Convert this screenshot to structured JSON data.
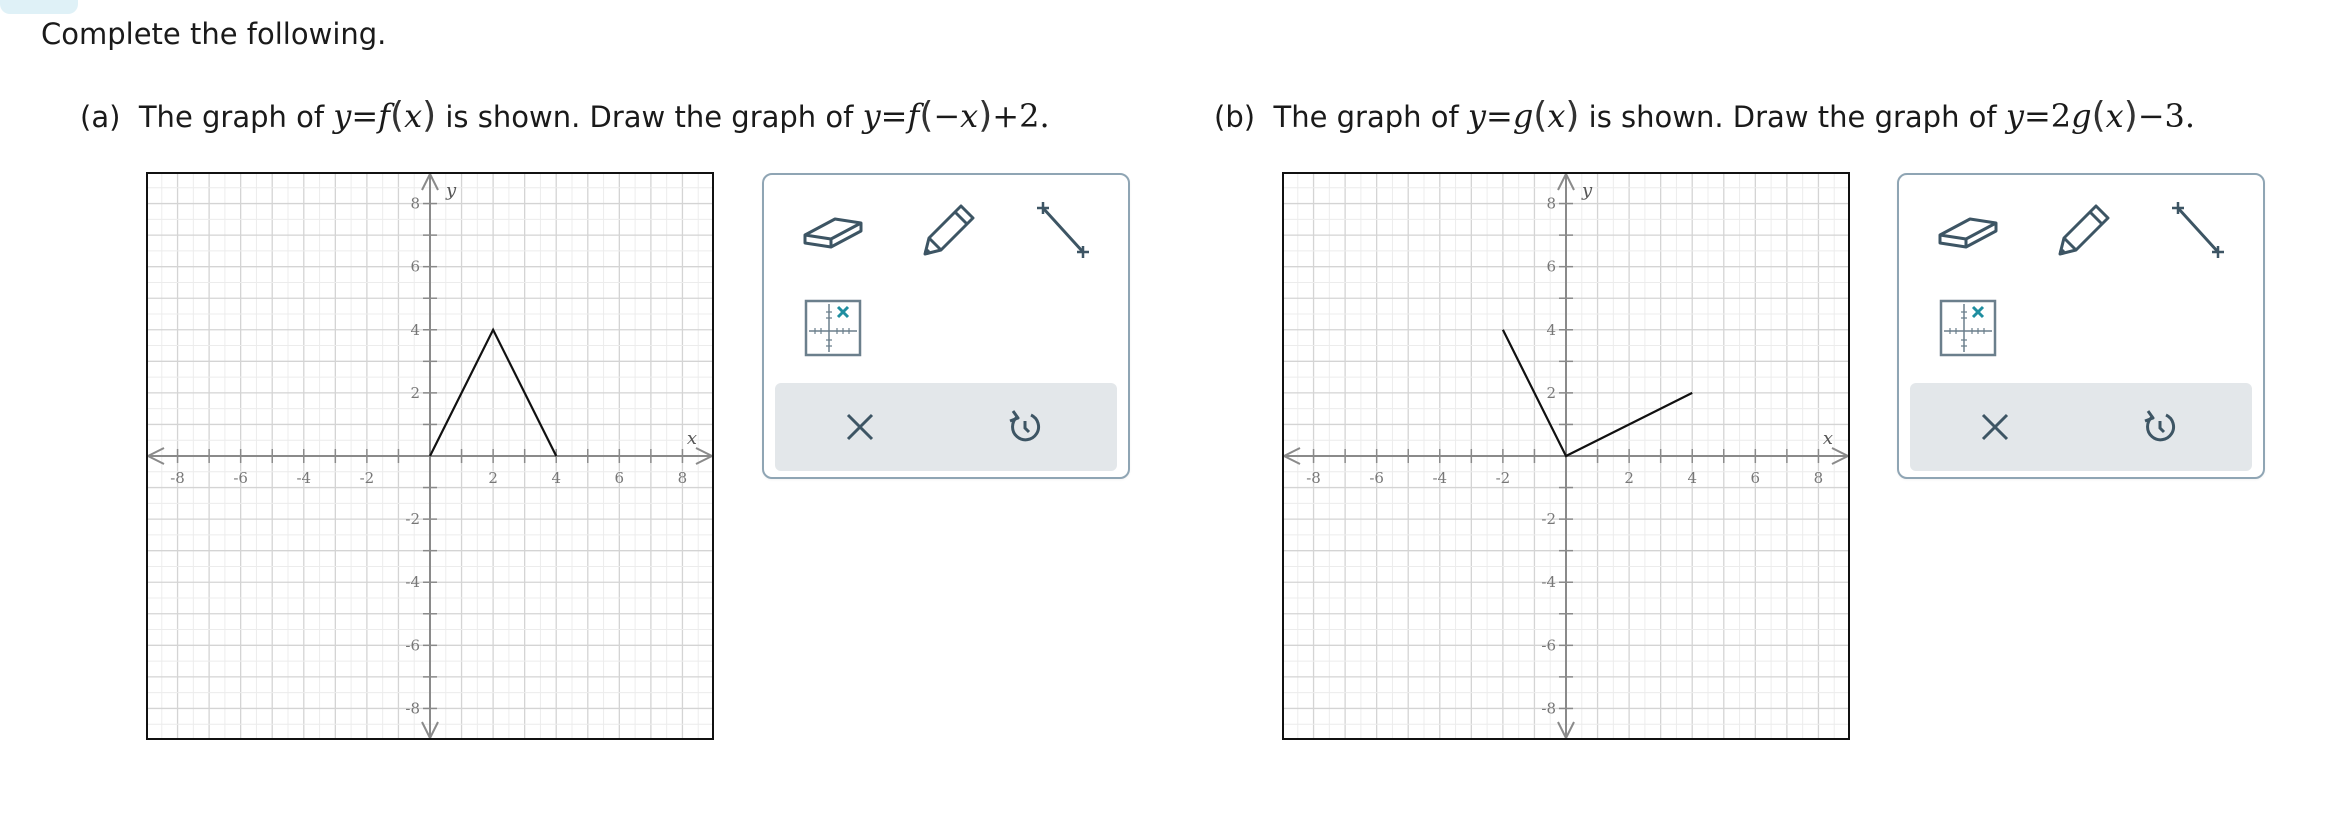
{
  "instruction": "Complete the following.",
  "parts": [
    {
      "label": "(a)",
      "text_before": "The graph of",
      "given": "y=f(x)",
      "text_middle": "is shown. Draw the graph of",
      "target": "y=f(−x)+2."
    },
    {
      "label": "(b)",
      "text_before": "The graph of",
      "given": "y=g(x)",
      "text_middle": "is shown. Draw the graph of",
      "target": "y=2g(x)−3."
    }
  ],
  "graph": {
    "x_label": "x",
    "y_label": "y",
    "x_range": [
      -9,
      9
    ],
    "y_range": [
      -9,
      9
    ],
    "x_ticks": [
      "-8",
      "-6",
      "-4",
      "-2",
      "2",
      "4",
      "6",
      "8"
    ],
    "y_ticks": [
      "8",
      "6",
      "4",
      "2",
      "-2",
      "-4",
      "-6",
      "-8"
    ]
  },
  "graph_a_polyline": [
    [
      0,
      0
    ],
    [
      2,
      4
    ],
    [
      4,
      0
    ]
  ],
  "graph_b_polyline": [
    [
      -2,
      4
    ],
    [
      0,
      0
    ],
    [
      4,
      2
    ]
  ],
  "toolbox": {
    "tools": [
      "eraser-icon",
      "pencil-icon",
      "segment-icon",
      "point-grid-icon"
    ],
    "actions": [
      "close-icon",
      "undo-icon"
    ],
    "accent": "#1f8ea0",
    "icon_color": "#3d5564"
  }
}
